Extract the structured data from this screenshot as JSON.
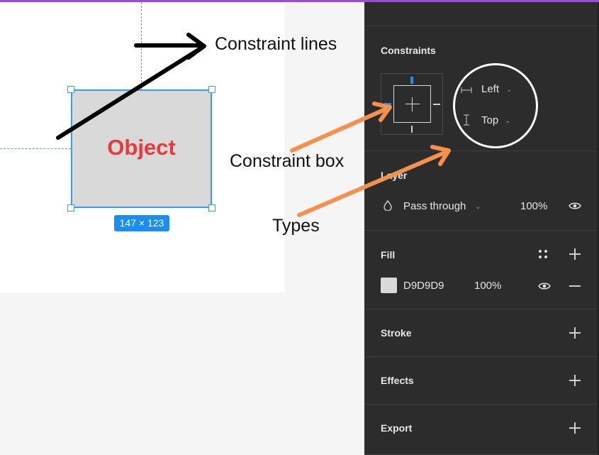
{
  "canvas": {
    "object_label": "Object",
    "dimensions": "147 × 123"
  },
  "annotations": {
    "constraint_lines": "Constraint lines",
    "constraint_box": "Constraint box",
    "types": "Types"
  },
  "panel": {
    "constraints": {
      "title": "Constraints",
      "horizontal": "Left",
      "vertical": "Top"
    },
    "layer": {
      "title": "Layer",
      "blend_mode": "Pass through",
      "opacity": "100%"
    },
    "fill": {
      "title": "Fill",
      "hex": "D9D9D9",
      "opacity": "100%"
    },
    "stroke": {
      "title": "Stroke"
    },
    "effects": {
      "title": "Effects"
    },
    "export": {
      "title": "Export"
    }
  },
  "colors": {
    "selection": "#3b9be6",
    "object_fill": "#d9d9d9",
    "object_label": "#e83a3a",
    "annotation_arrow_orange": "#f4914d",
    "panel_bg": "#2c2c2c"
  }
}
